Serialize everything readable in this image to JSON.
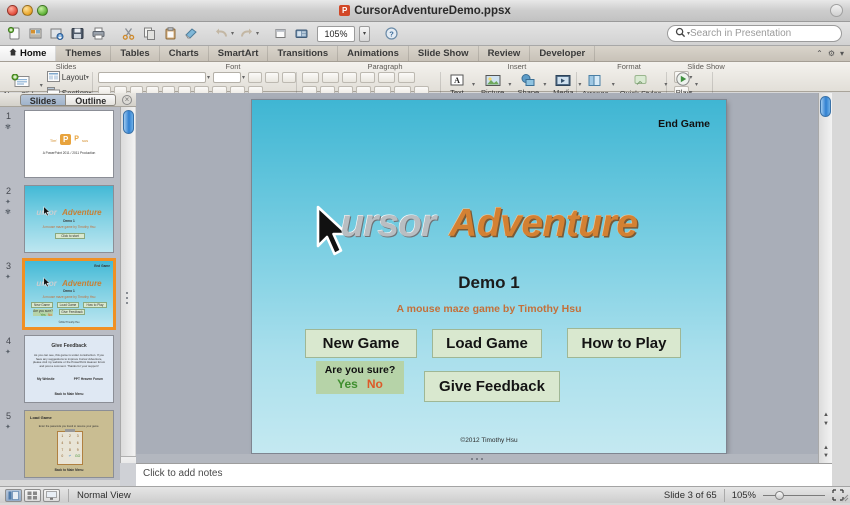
{
  "window": {
    "document_title": "CursorAdventureDemo.ppsx"
  },
  "toolbar": {
    "zoom_value": "105%",
    "icons": [
      {
        "name": "new-document-icon",
        "label": "New"
      },
      {
        "name": "open-folder-icon",
        "label": "Open"
      },
      {
        "name": "save-as-icon",
        "label": "Save As"
      },
      {
        "name": "save-icon",
        "label": "Save"
      },
      {
        "name": "print-icon",
        "label": "Print"
      },
      {
        "name": "cut-icon",
        "label": "Cut"
      },
      {
        "name": "copy-icon",
        "label": "Copy"
      },
      {
        "name": "paste-icon",
        "label": "Paste"
      },
      {
        "name": "format-painter-icon",
        "label": "Format"
      },
      {
        "name": "undo-icon",
        "label": "Undo"
      },
      {
        "name": "redo-icon",
        "label": "Redo"
      },
      {
        "name": "new-slide-icon",
        "label": "New Slide"
      },
      {
        "name": "media-browser-icon",
        "label": "Media Browser"
      },
      {
        "name": "help-icon",
        "label": "Help"
      }
    ]
  },
  "search": {
    "placeholder": "Search in Presentation",
    "value": ""
  },
  "ribbon": {
    "tabs": [
      {
        "label": "Home",
        "active": true
      },
      {
        "label": "Themes",
        "active": false
      },
      {
        "label": "Tables",
        "active": false
      },
      {
        "label": "Charts",
        "active": false
      },
      {
        "label": "SmartArt",
        "active": false
      },
      {
        "label": "Transitions",
        "active": false
      },
      {
        "label": "Animations",
        "active": false
      },
      {
        "label": "Slide Show",
        "active": false
      },
      {
        "label": "Review",
        "active": false
      },
      {
        "label": "Developer",
        "active": false
      }
    ],
    "groups": [
      {
        "label": "Slides"
      },
      {
        "label": "Font"
      },
      {
        "label": "Paragraph"
      },
      {
        "label": "Insert"
      },
      {
        "label": "Format"
      },
      {
        "label": "Slide Show"
      }
    ],
    "slides_group": {
      "new_slide": "New Slide",
      "layout": "Layout",
      "section": "Section"
    },
    "insert_group": {
      "text": "Text",
      "picture": "Picture",
      "shape": "Shape",
      "media": "Media"
    },
    "format_group": {
      "arrange": "Arrange",
      "quick_styles": "Quick Styles"
    },
    "slideshow_group": {
      "play": "Play"
    }
  },
  "slides_panel": {
    "tab_slides": "Slides",
    "tab_outline": "Outline",
    "thumbnails": [
      {
        "number": "1",
        "kind": "title",
        "line1": "Tim'",
        "line2": "sus",
        "caption": "A PowerPoint 2011 / 2011 Production"
      },
      {
        "number": "2",
        "kind": "cursor",
        "logo_c": "ursor",
        "logo_a": "Adventure",
        "sub": "Demo 1",
        "byline": "A mouse maze game by Timothy Hsu",
        "button": "Click to start"
      },
      {
        "number": "3",
        "kind": "cursor-menu",
        "selected": true,
        "end_game": "End Game",
        "logo_c": "ursor",
        "logo_a": "Adventure",
        "sub": "Demo 1",
        "byline": "A mouse maze game by Timothy Hsu",
        "buttons": [
          "New Game",
          "Load Game",
          "How to Play",
          "Give Feedback"
        ],
        "sure": "Are you sure?",
        "yes": "Yes",
        "no": "No"
      },
      {
        "number": "4",
        "kind": "feedback",
        "title": "Give Feedback",
        "body": "As you can see, this game is under construction. If you have any suggestions to improve Cursor Adventure, please visit my website or the PowerPoint Heaven forum and post a comment. Thanks for your support!",
        "link1": "My Website",
        "link2": "PPT Heaven Forum",
        "back": "Back to Main Menu"
      },
      {
        "number": "5",
        "kind": "load",
        "title": "Load Game",
        "sub": "Enter the passcode you found to resume your game.",
        "keys": [
          "1",
          "2",
          "3",
          "4",
          "5",
          "6",
          "7",
          "8",
          "9",
          "0"
        ],
        "back": "Back to Main Menu"
      }
    ]
  },
  "slide": {
    "end_game": "End Game",
    "logo_cursor": "ursor",
    "logo_adventure": "Adventure",
    "demo": "Demo 1",
    "byline": "A mouse maze game by Timothy Hsu",
    "buttons": {
      "new_game": "New Game",
      "load_game": "Load Game",
      "how_to_play": "How to Play",
      "give_feedback": "Give Feedback"
    },
    "confirm": {
      "question": "Are you sure?",
      "yes": "Yes",
      "no": "No"
    },
    "copyright": "©2012 Timothy Hsu"
  },
  "notes": {
    "placeholder": "Click to add notes"
  },
  "status": {
    "view_name": "Normal View",
    "slide_counter": "Slide 3 of 65",
    "zoom": "105%"
  },
  "colors": {
    "slide_top": "#3fb6d3",
    "slide_bottom": "#c4e9f1",
    "logo_orange": "#d38133",
    "logo_silver": "#b9bec2",
    "button_green": "#d9e8cf",
    "confirm_green": "#b6d3a8",
    "yes_green": "#3f8f2f",
    "no_orange": "#dd5a28",
    "selection_orange": "#f09022",
    "byline_orange": "#c4703a"
  }
}
